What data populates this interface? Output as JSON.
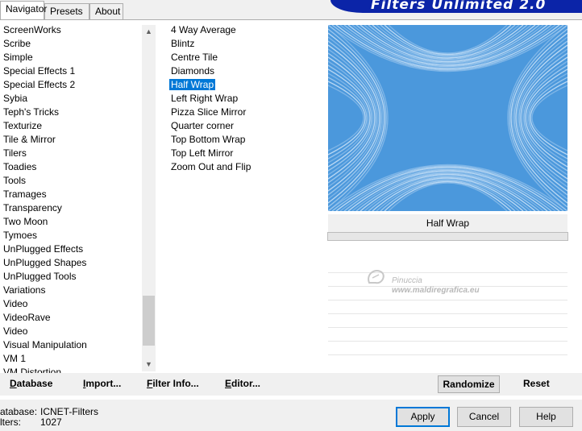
{
  "tabs": [
    {
      "label": "Navigator"
    },
    {
      "label": "Presets"
    },
    {
      "label": "About"
    }
  ],
  "banner": {
    "title": "Filters Unlimited 2.0"
  },
  "categories": [
    "ScreenWorks",
    "Scribe",
    "Simple",
    "Special Effects 1",
    "Special Effects 2",
    "Sybia",
    "Teph's Tricks",
    "Texturize",
    "Tile & Mirror",
    "Tilers",
    "Toadies",
    "Tools",
    "Tramages",
    "Transparency",
    "Two Moon",
    "Tymoes",
    "UnPlugged Effects",
    "UnPlugged Shapes",
    "UnPlugged Tools",
    "Variations",
    "Video",
    "VideoRave",
    "Video",
    "Visual Manipulation",
    "VM 1",
    "VM Distortion"
  ],
  "filters": [
    "4 Way Average",
    "Blintz",
    "Centre Tile",
    "Diamonds",
    "Half Wrap",
    "Left Right Wrap",
    "Pizza Slice Mirror",
    "Quarter corner",
    "Top Bottom Wrap",
    "Top Left Mirror",
    "Zoom Out and Flip"
  ],
  "selected_filter": "Half Wrap",
  "preview": {
    "label": "Half Wrap",
    "progress": 1.0
  },
  "watermark": {
    "line1": "Pinuccia",
    "line2": "www.maldiregrafica.eu"
  },
  "buttons": {
    "database": "Database",
    "import": "Import...",
    "filter_info": "Filter Info...",
    "editor": "Editor...",
    "randomize": "Randomize",
    "reset": "Reset",
    "apply": "Apply",
    "cancel": "Cancel",
    "help": "Help"
  },
  "footer": {
    "database_label": "atabase:",
    "database_value": "ICNET-Filters",
    "filters_label": "lters:",
    "filters_value": "1027"
  },
  "colors": {
    "selection": "#0078d7",
    "banner": "#0b24a8",
    "preview_blue": "#3d8fd8"
  }
}
